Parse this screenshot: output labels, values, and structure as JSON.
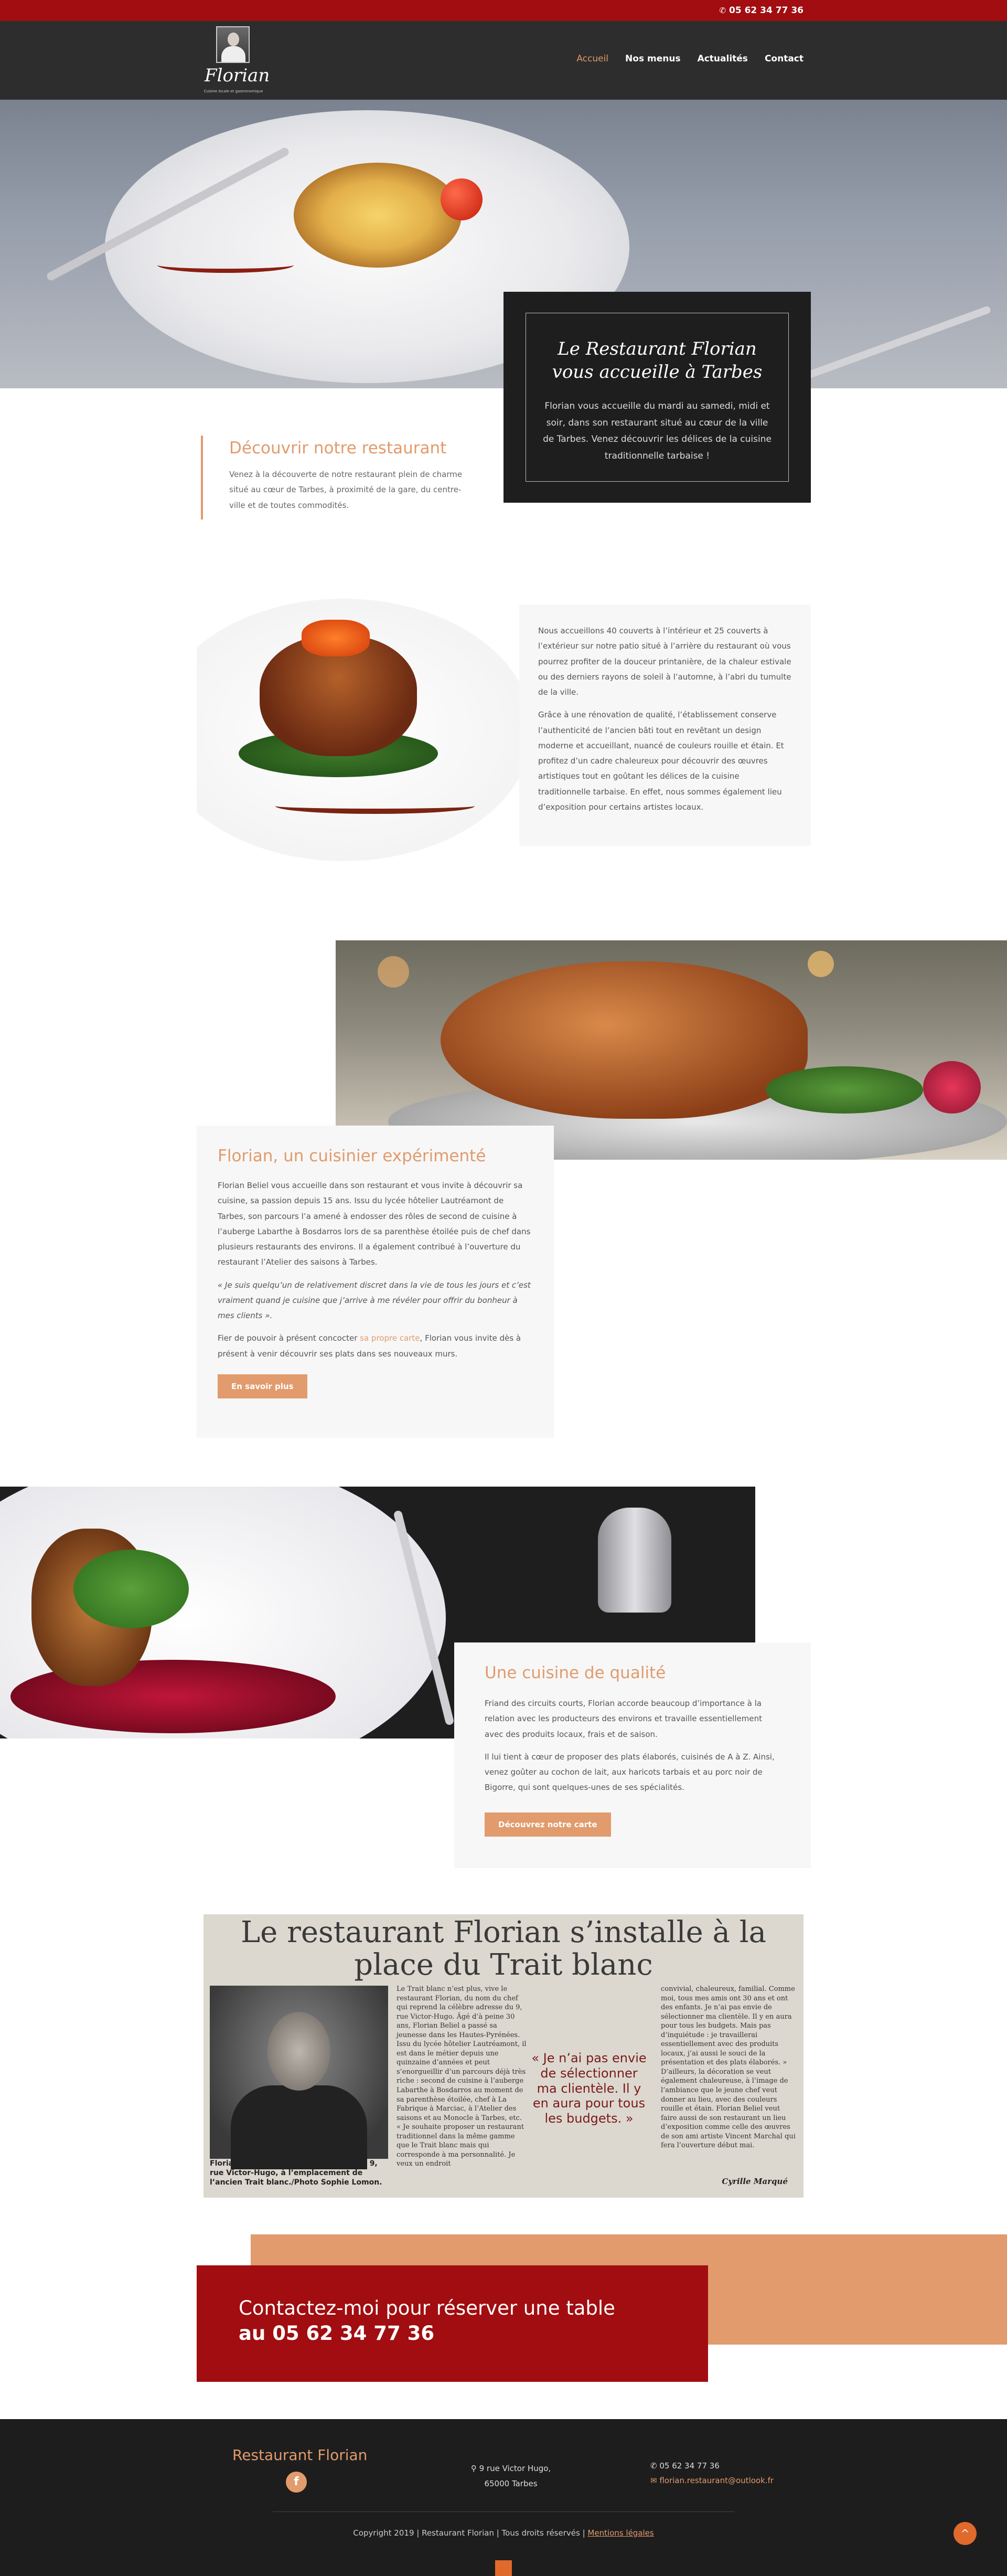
{
  "topbar": {
    "phone": "05 62 34 77 36",
    "phone_icon": "phone-icon"
  },
  "logo": {
    "name": "Florian",
    "tagline": "Cuisine locale et gastronomique"
  },
  "nav": {
    "items": [
      "Accueil",
      "Nos menus",
      "Actualités",
      "Contact"
    ],
    "active": "Accueil"
  },
  "hero": {
    "title": "Le Restaurant Florian vous accueille à Tarbes",
    "text": "Florian vous accueille du mardi au samedi, midi et soir, dans son restaurant situé au cœur de la ville de Tarbes. Venez découvrir les délices de la cuisine traditionnelle tarbaise !"
  },
  "discover": {
    "title": "Découvrir notre restaurant",
    "text": "Venez à la découverte de notre restaurant plein de charme situé au cœur de Tarbes, à proximité de la gare, du centre-ville et de toutes commodités."
  },
  "terrasse": {
    "p1": "Nous accueillons 40 couverts à l’intérieur et 25 couverts à l’extérieur sur notre patio situé à l’arrière du restaurant où vous pourrez profiter de la douceur printanière, de la chaleur estivale ou des derniers rayons de soleil à l’automne, à l’abri du tumulte de la ville.",
    "p2": "Grâce à une rénovation de qualité, l’établissement conserve l’authenticité de l’ancien bâti tout en revêtant un design moderne et accueillant, nuancé de couleurs rouille et étain. Et profitez d’un cadre chaleureux pour découvrir des œuvres artistiques tout en goûtant les délices de la cuisine traditionnelle tarbaise. En effet, nous sommes également lieu d’exposition pour certains artistes locaux."
  },
  "chef": {
    "title": "Florian, un cuisinier expérimenté",
    "p1": "Florian Beliel vous accueille dans son restaurant et vous invite à découvrir sa cuisine, sa passion depuis 15 ans. Issu du lycée hôtelier Lautréamont de Tarbes, son parcours l’a amené à endosser des rôles de second de cuisine à l’auberge Labarthe à Bosdarros lors de sa parenthèse étoilée puis de chef dans plusieurs restaurants des environs. Il a également contribué à l’ouverture du restaurant l’Atelier des saisons à Tarbes.",
    "quote": "« Je suis quelqu’un de relativement discret dans la vie de tous les jours et c’est vraiment quand je cuisine que j’arrive à me révéler pour offrir du bonheur à mes clients ».",
    "p3_before": "Fier de pouvoir à présent concocter ",
    "p3_link": "sa propre carte",
    "p3_after": ", Florian vous invite dès à présent à venir découvrir ses plats dans ses nouveaux murs.",
    "button": "En savoir plus"
  },
  "qualite": {
    "title": "Une cuisine de qualité",
    "p1": "Friand des circuits courts, Florian accorde beaucoup d’importance à la relation avec les producteurs des environs et travaille essentiellement avec des produits locaux, frais et de saison.",
    "p2": "Il lui tient à cœur de proposer des plats élaborés, cuisinés de A à Z. Ainsi, venez goûter au cochon de lait, aux haricots tarbais et au porc noir de Bigorre, qui sont quelques-unes de ses spécialités.",
    "button": "Découvrez notre carte"
  },
  "newspaper": {
    "headline": "Le restaurant Florian s’installe à la place du Trait blanc",
    "col1": "Le Trait blanc n’est plus, vive le restaurant Florian, du nom du chef qui reprend la célèbre adresse du 9, rue Victor-Hugo. Âgé d’à peine 30 ans, Florian Beliel a passé sa jeunesse dans les Hautes-Pyrénées. Issu du lycée hôtelier Lautréamont, il est dans le métier depuis une quinzaine d’années et peut s’enorgueillir d’un parcours déjà très riche : second de cuisine à l’auberge Labarthe à Bosdarros au moment de sa parenthèse étoilée, chef à La Fabrique à Marciac, à l’Atelier des saisons et au Monocle à Tarbes, etc. « Je souhaite proposer un restaurant traditionnel dans la même gamme que le Trait blanc mais qui corresponde à ma personnalité. Je veux un endroit",
    "pull": "« Je n’ai pas envie de sélectionner ma clientèle. Il y en aura pour tous les budgets. »",
    "col3": "convivial, chaleureux, familial. Comme moi, tous mes amis ont 30 ans et ont des enfants. Je n’ai pas envie de sélectionner ma clientèle. Il y en aura pour tous les budgets. Mais pas d’inquiétude : je travaillerai essentiellement avec des produits locaux, j’ai aussi le souci de la présentation et des plats élaborés. » D’ailleurs, la décoration se veut également chaleureuse, à l’image de l’ambiance que le jeune chef veut donner au lieu, avec des couleurs rouille et étain. Florian Beliel veut faire aussi de son restaurant un lieu d’exposition comme celle des œuvres de son ami artiste Vincent Marchal qui fera l’ouverture début mai.",
    "caption": "Florian Beliel ouvre son restaurant au 9, rue Victor-Hugo, à l’emplacement de l’ancien Trait blanc./Photo Sophie Lomon.",
    "signature": "Cyrille Marqué"
  },
  "contact": {
    "line1": "Contactez-moi pour réserver une table",
    "line2": "au 05 62 34 77 36"
  },
  "footer": {
    "brand": "Restaurant Florian",
    "facebook": "f",
    "address_l1": "9 rue Victor Hugo,",
    "address_l2": "65000 Tarbes",
    "phone": "05 62 34 77 36",
    "email": "florian.restaurant@outlook.fr",
    "copyright": "Copyright 2019 | Restaurant Florian | Tous droits réservés | ",
    "legal": "Mentions légales",
    "totop": "^"
  },
  "colors": {
    "accent": "#e19b6c",
    "brand_red": "#a10d10",
    "dark": "#1d1d1d"
  }
}
